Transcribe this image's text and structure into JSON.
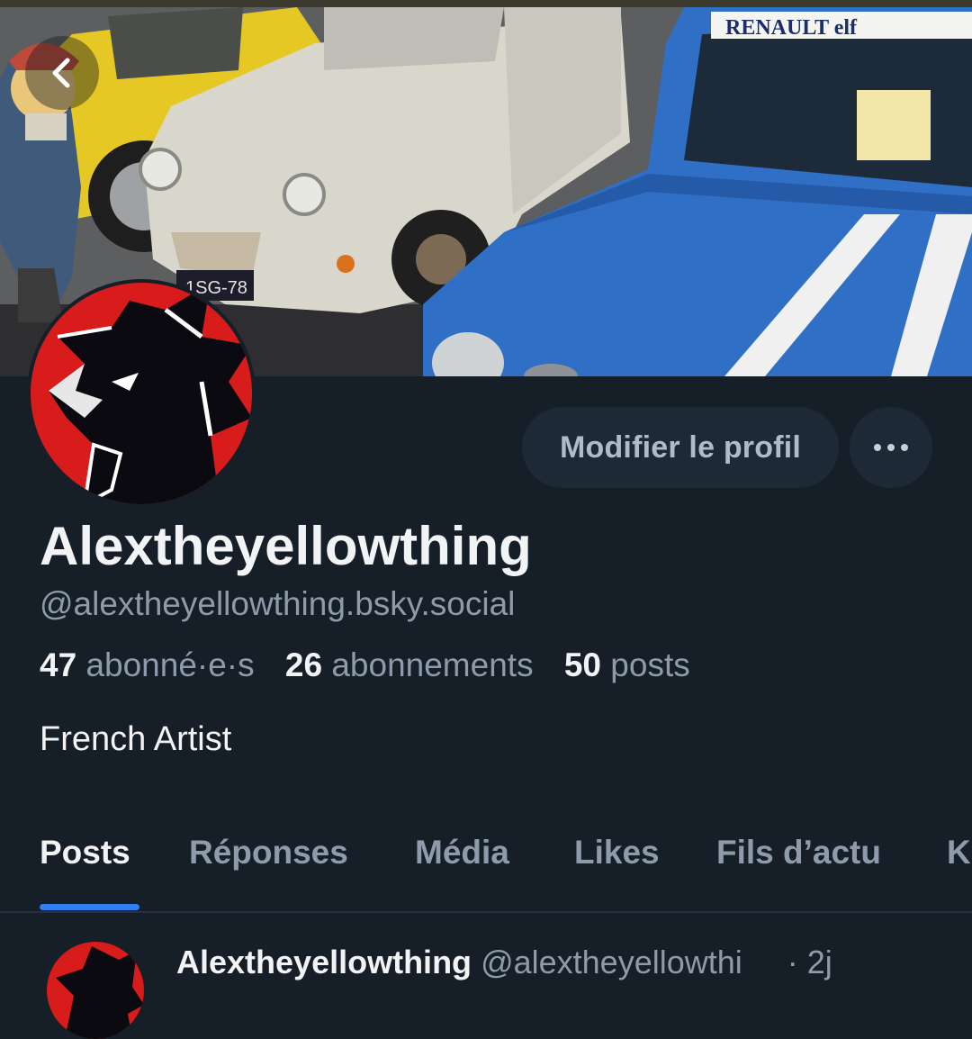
{
  "header": {
    "back_icon": "chevron-left-icon",
    "banner_plate_text": "1SG-78",
    "banner_brand_text": "RENAULT elf"
  },
  "profile": {
    "display_name": "Alextheyellowthing",
    "handle": "@alextheyellowthing.bsky.social",
    "bio": "French Artist",
    "edit_button_label": "Modifier le profil",
    "more_icon": "ellipsis-icon"
  },
  "stats": [
    {
      "count": "47",
      "label": "abonné·e·s"
    },
    {
      "count": "26",
      "label": "abonnements"
    },
    {
      "count": "50",
      "label": "posts"
    }
  ],
  "tabs": [
    {
      "label": "Posts",
      "active": true
    },
    {
      "label": "Réponses",
      "active": false
    },
    {
      "label": "Média",
      "active": false
    },
    {
      "label": "Likes",
      "active": false
    },
    {
      "label": "Fils d’actu",
      "active": false
    },
    {
      "label": "K",
      "active": false
    }
  ],
  "post_preview": {
    "author": "Alextheyellowthing",
    "handle": "@alextheyellowthi",
    "time": "· 2j"
  },
  "colors": {
    "background": "#161e27",
    "accent": "#2f7ff0",
    "button_bg": "#1e2936",
    "muted_text": "#8d9bab"
  }
}
